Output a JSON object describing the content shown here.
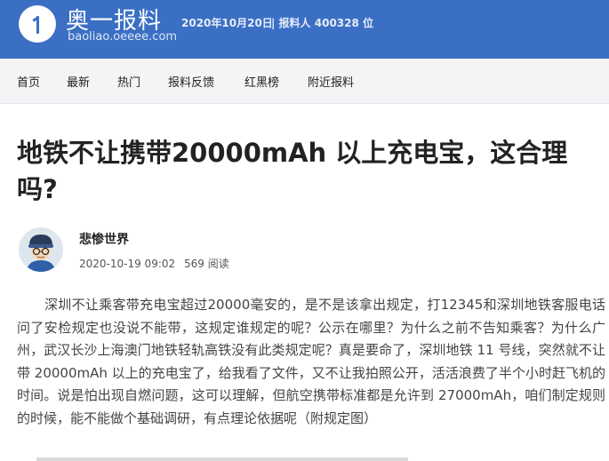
{
  "header": {
    "brand_name": "奥一报料",
    "brand_url": "baoliao.oeeee.com",
    "date": "2020年10月20日",
    "reporters": "| 报料人  400328 位"
  },
  "nav": {
    "items": [
      {
        "label": "首页"
      },
      {
        "label": "最新"
      },
      {
        "label": "热门"
      },
      {
        "label": "报料反馈"
      },
      {
        "label": "红黑榜"
      },
      {
        "label": "附近报料"
      }
    ]
  },
  "article": {
    "title": "地铁不让携带20000mAh 以上充电宝，这合理吗?",
    "author": "悲惨世界",
    "datetime": "2020-10-19 09:02",
    "reads": "569 阅读",
    "body": "深圳不让乘客带充电宝超过20000毫安的，是不是该拿出规定，打12345和深圳地铁客服电话问了安检规定也没说不能带，这规定谁规定的呢？公示在哪里？为什么之前不告知乘客？为什么广州，武汉长沙上海澳门地铁轻轨高铁没有此类规定呢？真是要命了，深圳地铁 11 号线，突然就不让带 20000mAh 以上的充电宝了，给我看了文件，又不让我拍照公开，活活浪费了半个小时赶飞机的时间。说是怕出现自燃问题，这可以理解，但航空携带标准都是允许到 27000mAh，咱们制定规则的时候，能不能做个基础调研，有点理论依据呢（附规定图）"
  },
  "colors": {
    "header_bg": "#3a6fc4",
    "nav_bg": "#f3f4f6"
  }
}
